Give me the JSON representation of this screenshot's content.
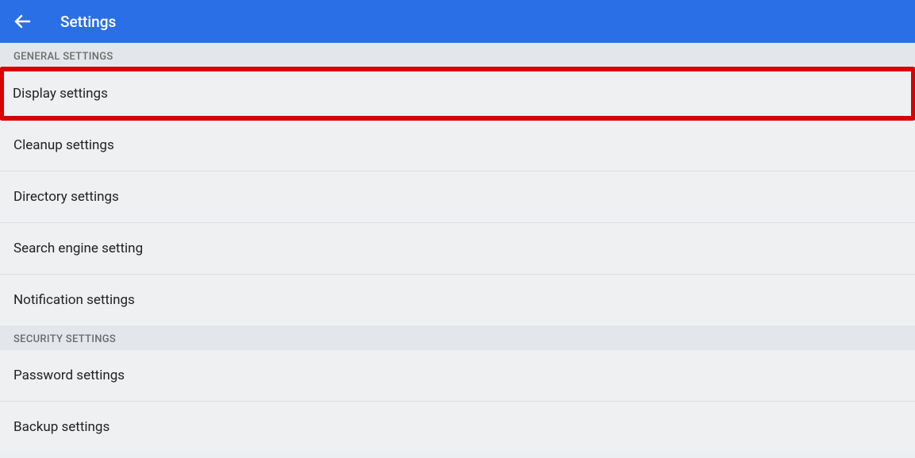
{
  "header": {
    "title": "Settings"
  },
  "sections": {
    "general": {
      "header": "GENERAL SETTINGS",
      "items": {
        "display": "Display settings",
        "cleanup": "Cleanup settings",
        "directory": "Directory settings",
        "search_engine": "Search engine setting",
        "notification": "Notification settings"
      }
    },
    "security": {
      "header": "SECURITY SETTINGS",
      "items": {
        "password": "Password settings",
        "backup": "Backup settings"
      }
    }
  }
}
